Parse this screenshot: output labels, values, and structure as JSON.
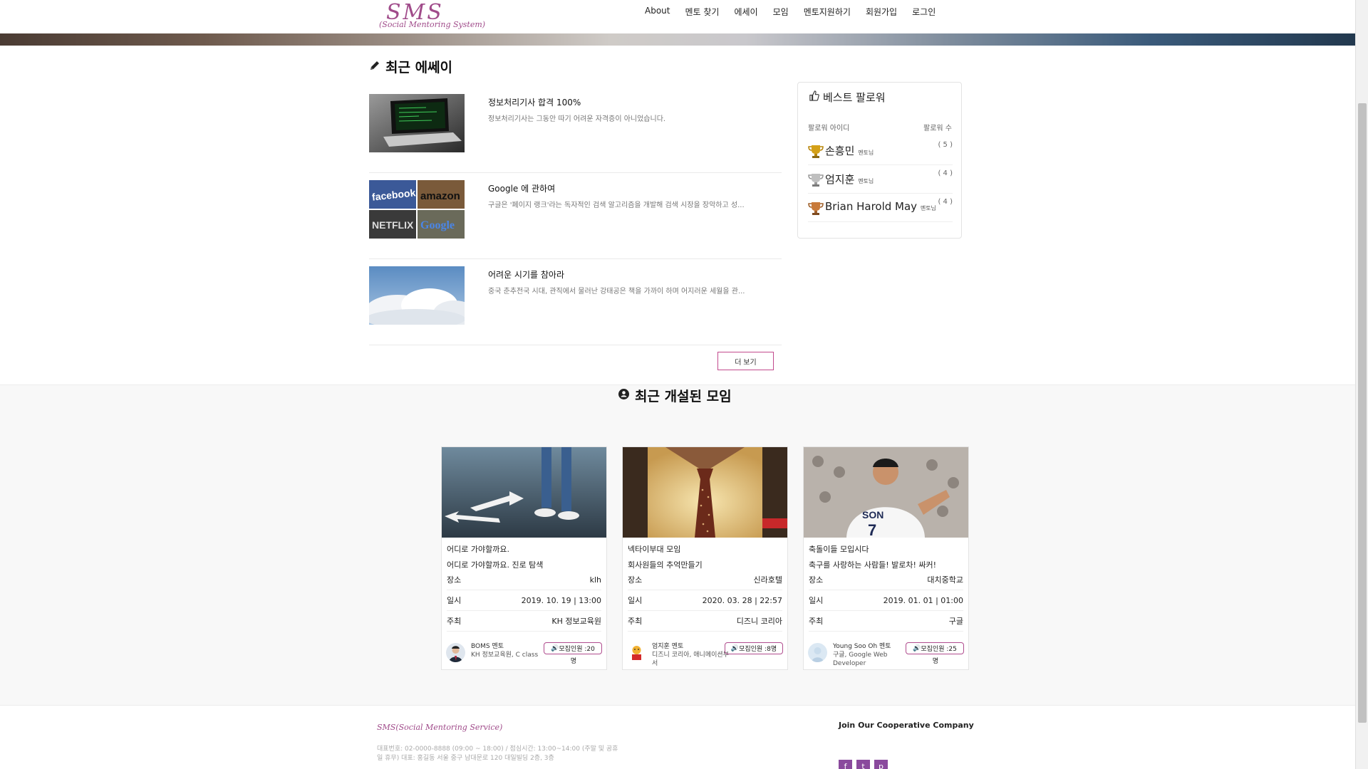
{
  "header": {
    "logo_title": "SMS",
    "logo_subtitle": "(Social Mentoring System)",
    "nav": [
      "About",
      "멘토 찾기",
      "에세이",
      "모임",
      "멘토지원하기",
      "회원가입",
      "로그인"
    ]
  },
  "essays": {
    "title": "최근 에쎄이",
    "items": [
      {
        "title": "정보처리기사 합격 100%",
        "excerpt": "정보처리기사는 그동안 따기 어려운 자격증이 아니었습니다."
      },
      {
        "title": "Google 에 관하여",
        "excerpt": "구글은 '페이지 랭크'라는 독자적인 검색 알고리즘을 개발해 검색 시장을 장악하고 성..."
      },
      {
        "title": "어려운 시기를 참아라",
        "excerpt": "중국 춘추전국 시대, 관직에서 물러난 강태공은 책을 가까이 하며 어지러운 세월을 관..."
      }
    ],
    "more_label": "더 보기"
  },
  "best": {
    "title": "베스트 팔로워",
    "col_id": "팔로워 아이디",
    "col_count": "팔로워 수",
    "tag": "멘토님",
    "rows": [
      {
        "name": "손흥민",
        "count": "( 5 )"
      },
      {
        "name": "엄지훈",
        "count": "( 4 )"
      },
      {
        "name": "Brian Harold May",
        "count": "( 4 )"
      }
    ]
  },
  "meetings": {
    "title": "최근 개설된 모임",
    "labels": {
      "place": "장소",
      "date": "일시",
      "host": "주최"
    },
    "cards": [
      {
        "name": "어디로 가야할까요.",
        "desc": "어디로 가야할까요. 진로 탐색",
        "place": "klh",
        "date": "2019. 10. 19 | 13:00",
        "host": "KH 정보교육원",
        "mentor": "BOMS 멘토",
        "mentor_sub": "KH 정보교육원, C class",
        "recruit": "모집인원 :20",
        "unit": "명"
      },
      {
        "name": "넥타이부대 모임",
        "desc": "회사원들의 추억만들기",
        "place": "신라호텔",
        "date": "2020. 03. 28 | 22:57",
        "host": "디즈니 코리아",
        "mentor": "엄지훈 멘토",
        "mentor_sub": "디즈니 코리아, 애니메이션부서",
        "recruit": "모집인원 :8명",
        "unit": ""
      },
      {
        "name": "축돌이들 모입시다",
        "desc": "축구를 사랑하는 사람들! 발로차! 싸커!",
        "place": "대치중학교",
        "date": "2019. 01. 01 | 01:00",
        "host": "구글",
        "mentor": "Young Soo Oh 멘토",
        "mentor_sub": "구글, Google Web Developer",
        "recruit": "모집인원 :25",
        "unit": "명"
      }
    ]
  },
  "footer": {
    "brand": "SMS(Social Mentoring Service)",
    "info": "대표번호: 02-0000-8888 (09:00 ~ 18:00) / 점심시간: 13:00~14:00 (주말 및 공휴일 휴무) 대표: 홍길동 서울 중구 남대문로 120 대일빌딩 2층, 3층",
    "join": "Join Our Cooperative Company",
    "socials": [
      "f",
      "t",
      "p"
    ]
  },
  "colors": {
    "accent": "#a04b8a",
    "button_border": "#c24a8d",
    "social": "#8a4a9d"
  }
}
